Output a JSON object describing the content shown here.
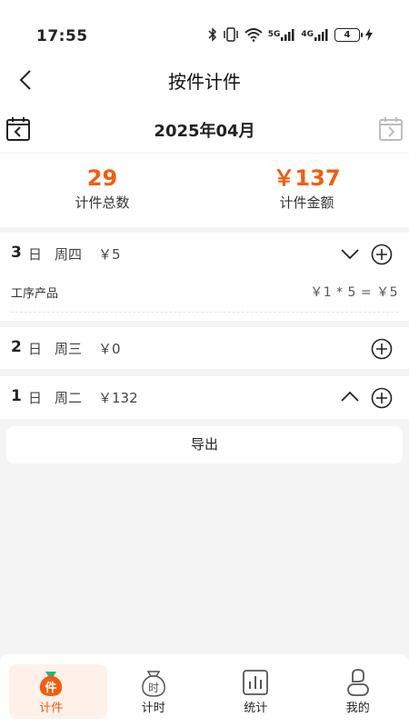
{
  "status": {
    "time": "17:55",
    "net1": "5G",
    "net2": "4G",
    "battery": "4"
  },
  "nav": {
    "title": "按件计件"
  },
  "month": {
    "title": "2025年04月"
  },
  "summary": {
    "total_count": "29",
    "total_count_label": "计件总数",
    "total_amount": "￥137",
    "total_amount_label": "计件金额"
  },
  "days": [
    {
      "day": "3",
      "unit": "日",
      "weekday": "周四",
      "amount": "￥5",
      "expanded": true,
      "items": [
        {
          "name": "工序产品",
          "calc": "￥1 * 5 =  ￥5"
        }
      ]
    },
    {
      "day": "2",
      "unit": "日",
      "weekday": "周三",
      "amount": "￥0",
      "expanded": false,
      "items": []
    },
    {
      "day": "1",
      "unit": "日",
      "weekday": "周二",
      "amount": "￥132",
      "expanded": false,
      "items": []
    }
  ],
  "export": {
    "label": "导出"
  },
  "tabs": [
    {
      "label": "计件",
      "icon": "piece-bag-icon",
      "glyph": "件",
      "active": true
    },
    {
      "label": "计时",
      "icon": "time-bag-icon",
      "glyph": "时",
      "active": false
    },
    {
      "label": "统计",
      "icon": "statistics-chart-icon",
      "active": false
    },
    {
      "label": "我的",
      "icon": "profile-icon",
      "active": false
    }
  ],
  "colors": {
    "accent": "#f25d0e",
    "background": "#f4f4f4",
    "tab_active_bg": "#fdf1ea"
  }
}
